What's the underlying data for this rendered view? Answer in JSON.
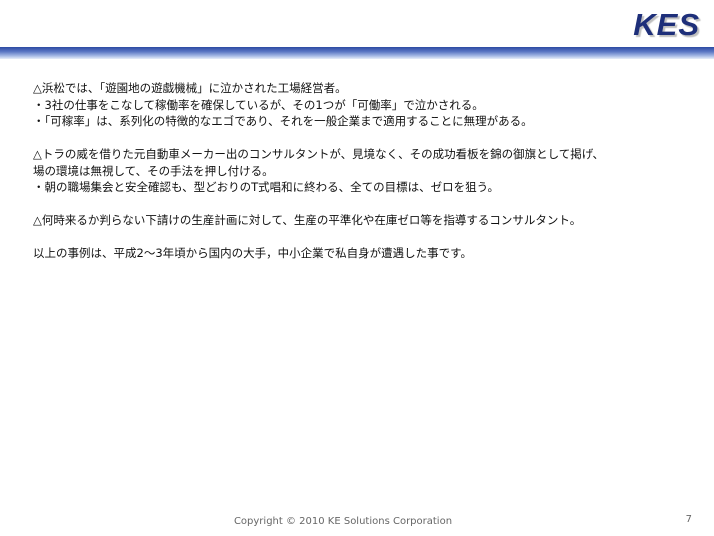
{
  "header": {
    "logo_text": "KES",
    "accent_color": "#2c4aa3"
  },
  "content": {
    "lines": [
      "△浜松では、「遊園地の遊戯機械」に泣かされた工場経営者。",
      "・3社の仕事をこなして稼働率を確保しているが、その1つが「可働率」で泣かされる。",
      "・「可稼率」は、系列化の特徴的なエゴであり、それを一般企業まで適用することに無理がある。",
      "△トラの威を借りた元自動車メーカー出のコンサルタントが、見境なく、その成功看板を錦の御旗として掲げ、",
      "場の環境は無視して、その手法を押し付ける。",
      "・朝の職場集会と安全確認も、型どおりのT式唱和に終わる、全ての目標は、ゼロを狙う。",
      "△何時来るか判らない下請けの生産計画に対して、生産の平準化や在庫ゼロ等を指導するコンサルタント。",
      "以上の事例は、平成2〜3年頃から国内の大手，中小企業で私自身が遭遇した事です。"
    ]
  },
  "footer": {
    "copyright": "Copyright   © 2010 KE Solutions  Corporation",
    "page_number": "7"
  }
}
